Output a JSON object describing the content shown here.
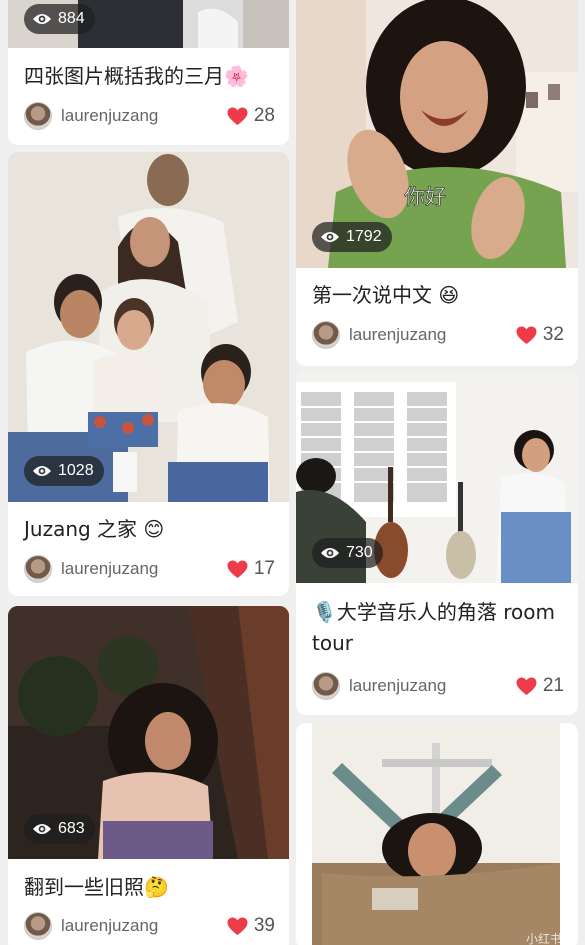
{
  "colors": {
    "heart": "#ee3b4a",
    "author_text": "#666666",
    "title_text": "#222222",
    "background": "#efefef"
  },
  "icons": {
    "views": "eye-icon",
    "likes": "heart-icon",
    "author": "avatar"
  },
  "posts": [
    {
      "views": "884",
      "title": "四张图片概括我的三月🌸",
      "author": "laurenjuzang",
      "likes": "28"
    },
    {
      "views": "1028",
      "title": "Juzang 之家 😊",
      "author": "laurenjuzang",
      "likes": "17"
    },
    {
      "views": "683",
      "title": "翻到一些旧照🤔",
      "author": "laurenjuzang",
      "likes": "39"
    },
    {
      "image_text": "你好",
      "views": "1792",
      "title": "第一次说中文 😆",
      "author": "laurenjuzang",
      "likes": "32"
    },
    {
      "views": "730",
      "title": "🎙️大学音乐人的角落 room tour",
      "author": "laurenjuzang",
      "likes": "21"
    },
    {
      "watermark": "小红书"
    }
  ]
}
